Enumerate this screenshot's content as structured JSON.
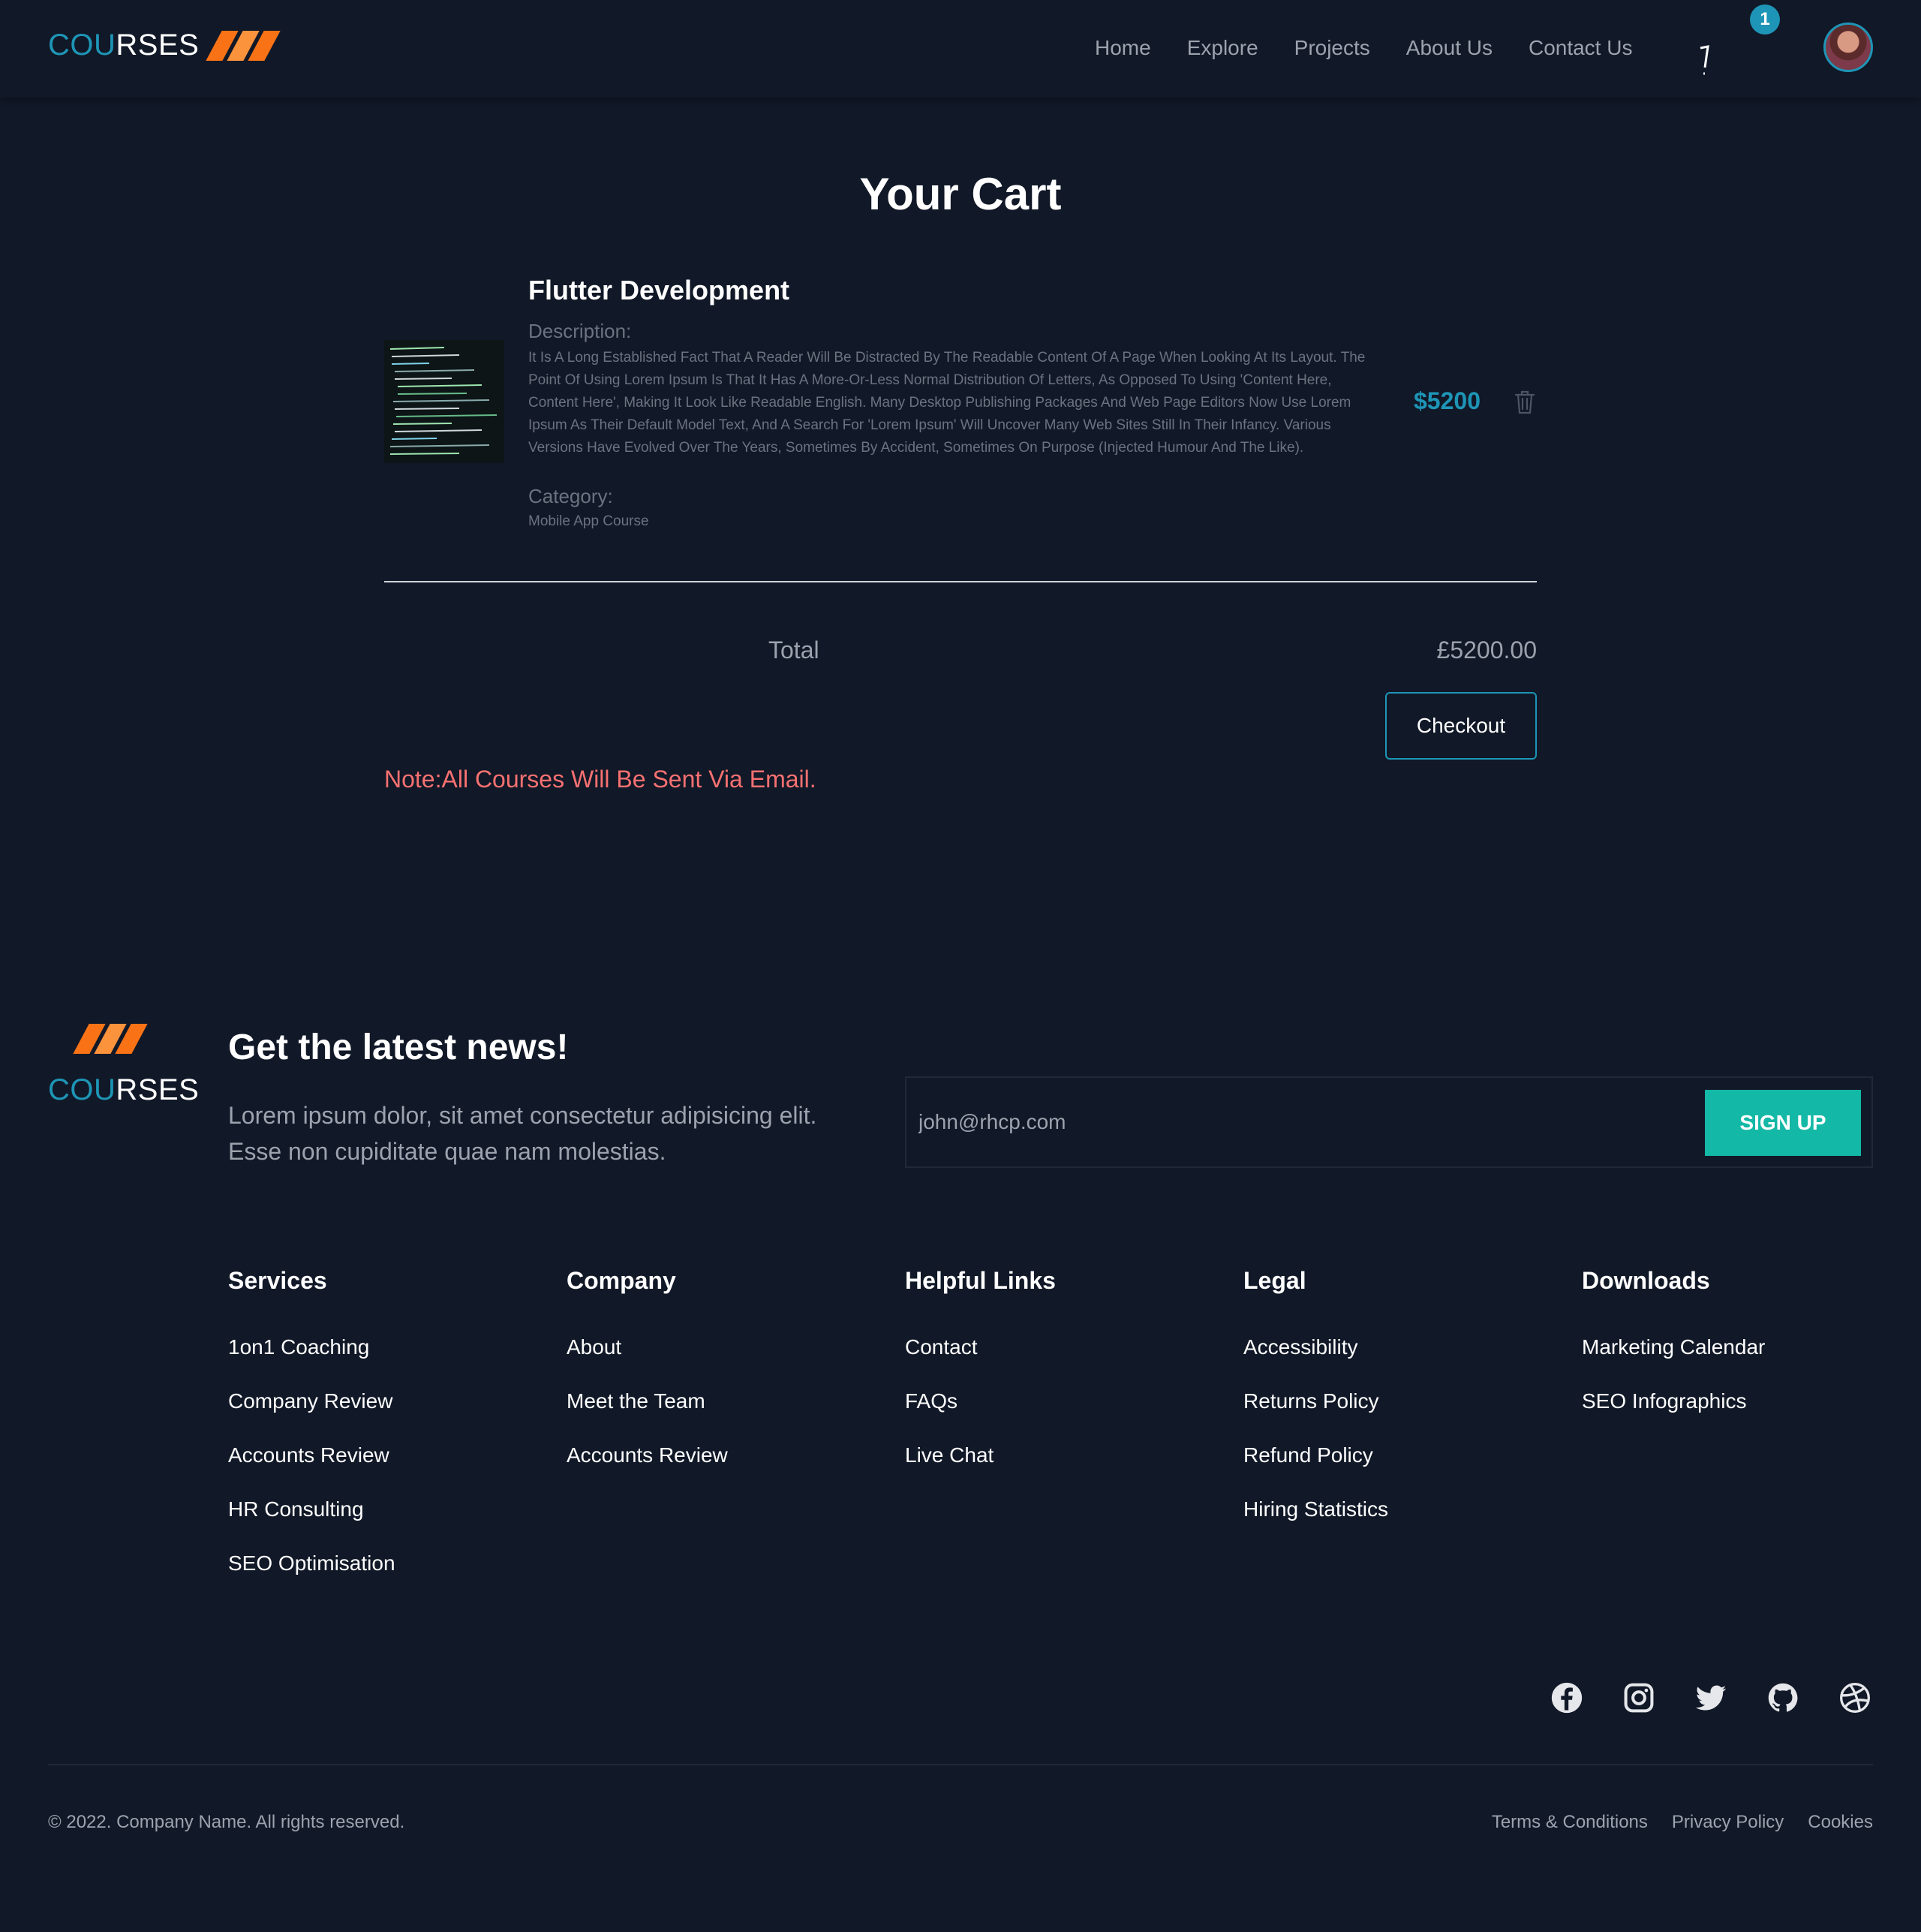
{
  "brand": {
    "part1": "COU",
    "part2": "RSES"
  },
  "nav": {
    "links": [
      "Home",
      "Explore",
      "Projects",
      "About Us",
      "Contact Us"
    ],
    "cart_count": "1"
  },
  "cart": {
    "title": "Your Cart",
    "item": {
      "title": "Flutter Development",
      "description_label": "Description:",
      "description": "It Is A Long Established Fact That A Reader Will Be Distracted By The Readable Content Of A Page When Looking At Its Layout. The Point Of Using Lorem Ipsum Is That It Has A More-Or-Less Normal Distribution Of Letters, As Opposed To Using 'Content Here, Content Here', Making It Look Like Readable English. Many Desktop Publishing Packages And Web Page Editors Now Use Lorem Ipsum As Their Default Model Text, And A Search For 'Lorem Ipsum' Will Uncover Many Web Sites Still In Their Infancy. Various Versions Have Evolved Over The Years, Sometimes By Accident, Sometimes On Purpose (Injected Humour And The Like).",
      "category_label": "Category:",
      "category": "Mobile App Course",
      "price": "$5200"
    },
    "total_label": "Total",
    "total_value": "£5200.00",
    "checkout_label": "Checkout",
    "note": "Note:All Courses Will Be Sent Via Email."
  },
  "newsletter": {
    "title": "Get the latest news!",
    "text": "Lorem ipsum dolor, sit amet consectetur adipisicing elit. Esse non cupiditate quae nam molestias.",
    "email_value": "john@rhcp.com",
    "signup_label": "Sign up"
  },
  "footer": {
    "columns": [
      {
        "title": "Services",
        "links": [
          "1on1 Coaching",
          "Company Review",
          "Accounts Review",
          "HR Consulting",
          "SEO Optimisation"
        ]
      },
      {
        "title": "Company",
        "links": [
          "About",
          "Meet the Team",
          "Accounts Review"
        ]
      },
      {
        "title": "Helpful Links",
        "links": [
          "Contact",
          "FAQs",
          "Live Chat"
        ]
      },
      {
        "title": "Legal",
        "links": [
          "Accessibility",
          "Returns Policy",
          "Refund Policy",
          "Hiring Statistics"
        ]
      },
      {
        "title": "Downloads",
        "links": [
          "Marketing Calendar",
          "SEO Infographics"
        ]
      }
    ],
    "socials": [
      "facebook-icon",
      "instagram-icon",
      "twitter-icon",
      "github-icon",
      "dribbble-icon"
    ],
    "copyright": "© 2022. Company Name. All rights reserved.",
    "bottom_links": [
      "Terms & Conditions",
      "Privacy Policy",
      "Cookies"
    ]
  },
  "colors": {
    "background": "#111827",
    "accent": "#1e95b6",
    "brand_orange": "#f97316",
    "signup_button": "#14b8a6",
    "note": "#f87171"
  }
}
